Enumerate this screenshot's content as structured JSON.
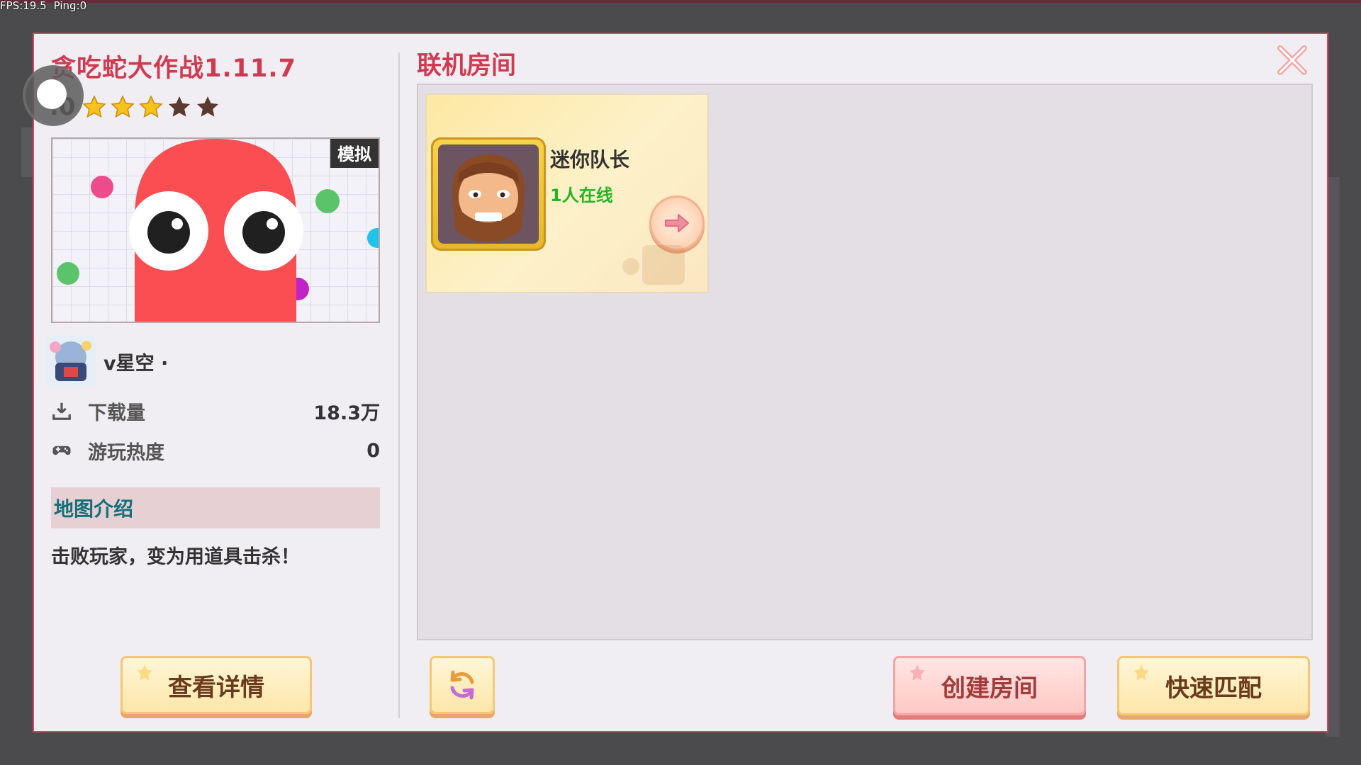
{
  "debug": {
    "fps": "FPS:19.5",
    "ping": "Ping:0"
  },
  "map": {
    "title": "贪吃蛇大作战1.11.7",
    "rating": ".0",
    "stars_filled": 3,
    "stars_total": 5,
    "tag": "模拟",
    "author": "v星空 ·",
    "downloads_label": "下载量",
    "downloads_value": "18.3万",
    "heat_label": "游玩热度",
    "heat_value": "0",
    "intro_header": "地图介绍",
    "intro_text": "击败玩家，变为用道具击杀！",
    "details_button": "查看详情"
  },
  "rooms": {
    "title": "联机房间",
    "items": [
      {
        "name": "迷你队长",
        "online": "1人在线"
      }
    ],
    "create_button": "创建房间",
    "quick_match_button": "快速匹配"
  },
  "colors": {
    "accent": "#d03a50",
    "online": "#25b425",
    "intro": "#13707a"
  },
  "icons": [
    "close-icon",
    "star-icon",
    "download-icon",
    "gamepad-icon",
    "refresh-icon",
    "arrow-right-icon"
  ]
}
